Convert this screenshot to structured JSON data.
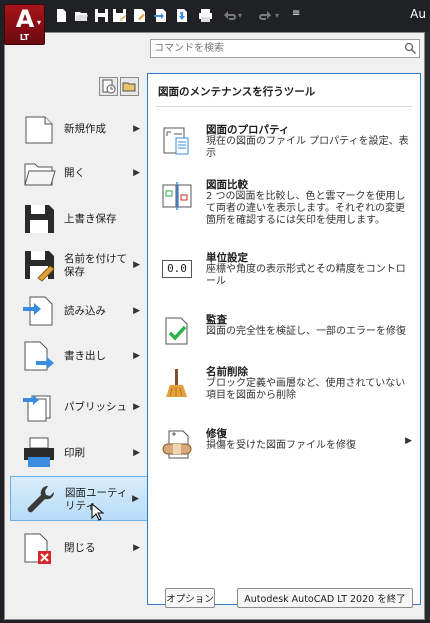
{
  "titlebar": {
    "app_letter": "A",
    "app_badge": "LT",
    "right_text": "Au"
  },
  "search": {
    "placeholder": "コマンドを検索"
  },
  "commands": [
    {
      "label": "新規作成",
      "has_arrow": true
    },
    {
      "label": "開く",
      "has_arrow": true
    },
    {
      "label": "上書き保存",
      "has_arrow": false
    },
    {
      "label": "名前を付けて保存",
      "has_arrow": true
    },
    {
      "label": "読み込み",
      "has_arrow": true
    },
    {
      "label": "書き出し",
      "has_arrow": true
    },
    {
      "label": "パブリッシュ",
      "has_arrow": true
    },
    {
      "label": "印刷",
      "has_arrow": true
    },
    {
      "label": "図面ユーティリティ",
      "has_arrow": true,
      "selected": true
    },
    {
      "label": "閉じる",
      "has_arrow": true
    }
  ],
  "panel": {
    "title": "図面のメンテナンスを行うツール",
    "tools": [
      {
        "title": "図面のプロパティ",
        "desc": "現在の図面のファイル プロパティを設定、表示"
      },
      {
        "title": "図面比較",
        "desc": "2 つの図面を比較し、色と雲マークを使用して両者の違いを表示します。それぞれの変更箇所を確認するには矢印を使用します。"
      },
      {
        "title": "単位設定",
        "desc": "座標や角度の表示形式とその精度をコントロール"
      },
      {
        "title": "監査",
        "desc": "図面の完全性を検証し、一部のエラーを修復"
      },
      {
        "title": "名前削除",
        "desc": "ブロック定義や画層など、使用されていない項目を図面から削除"
      },
      {
        "title": "修復",
        "desc": "損傷を受けた図面ファイルを修復",
        "has_arrow": true
      }
    ]
  },
  "unit_icon_text": "0.0",
  "footer": {
    "options_label": "オプション",
    "exit_label": "Autodesk AutoCAD LT 2020 を終了"
  },
  "colors": {
    "accent": "#2f78c8",
    "app_red": "#a8131a",
    "selected_bg": "#c6e2f9"
  }
}
